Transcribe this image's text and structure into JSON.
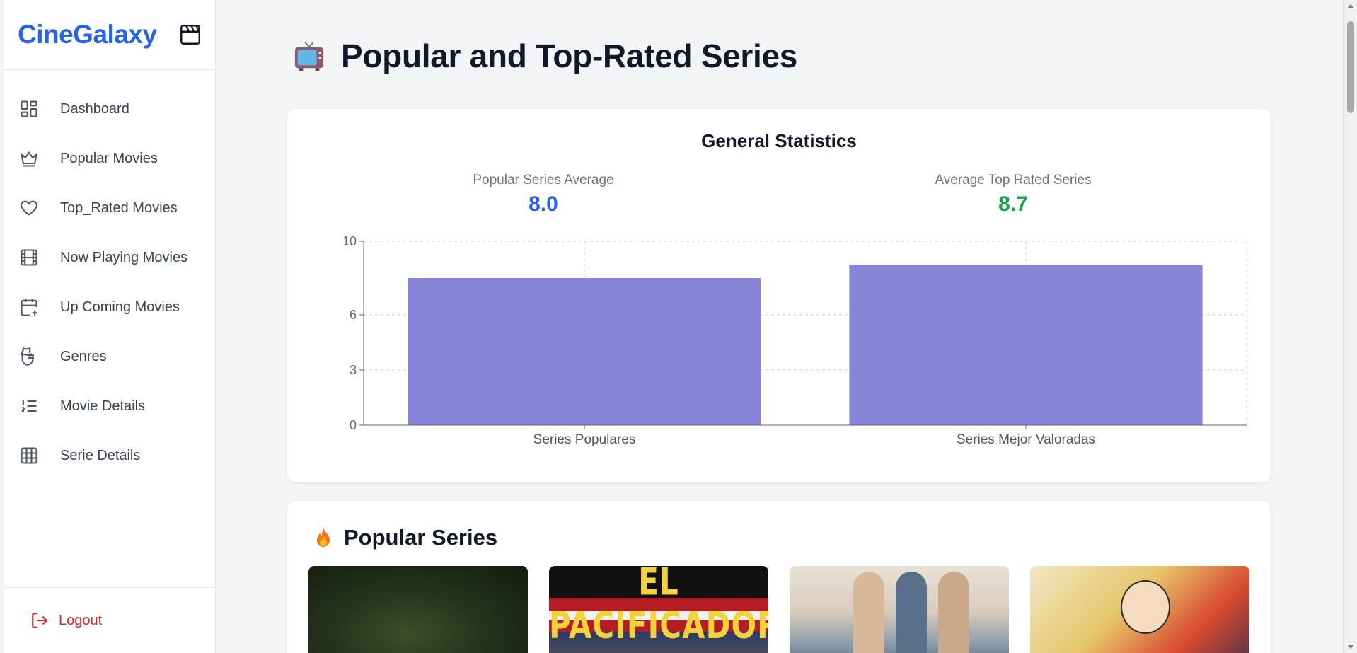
{
  "app": {
    "name": "CineGalaxy"
  },
  "sidebar": {
    "items": [
      {
        "label": "Dashboard",
        "icon": "dashboard-icon"
      },
      {
        "label": "Popular Movies",
        "icon": "crown-icon"
      },
      {
        "label": "Top_Rated Movies",
        "icon": "heart-icon"
      },
      {
        "label": "Now Playing Movies",
        "icon": "film-icon"
      },
      {
        "label": "Up Coming Movies",
        "icon": "calendar-plus-icon"
      },
      {
        "label": "Genres",
        "icon": "theater-masks-icon"
      },
      {
        "label": "Movie Details",
        "icon": "list-ordered-icon"
      },
      {
        "label": "Serie Details",
        "icon": "grid-icon"
      }
    ],
    "logout_label": "Logout"
  },
  "page": {
    "title": "Popular and Top-Rated Series"
  },
  "stats": {
    "title": "General Statistics",
    "popular_label": "Popular Series Average",
    "popular_value": "8.0",
    "top_label": "Average Top Rated Series",
    "top_value": "8.7"
  },
  "colors": {
    "brand": "#2563eb",
    "popular_value": "#2563eb",
    "top_value": "#16a34a",
    "bar": "#8884d8",
    "logout": "#dc2626"
  },
  "chart_data": {
    "type": "bar",
    "categories": [
      "Series Populares",
      "Series Mejor Valoradas"
    ],
    "values": [
      8.0,
      8.7
    ],
    "ylim": [
      0,
      10
    ],
    "yticks": [
      0,
      3,
      6,
      10
    ],
    "grid": true
  },
  "popular": {
    "title": "Popular Series",
    "posters": [
      {
        "text": ""
      },
      {
        "text": "EL PACIFICADOR"
      },
      {
        "text": ""
      },
      {
        "text": ""
      }
    ]
  }
}
